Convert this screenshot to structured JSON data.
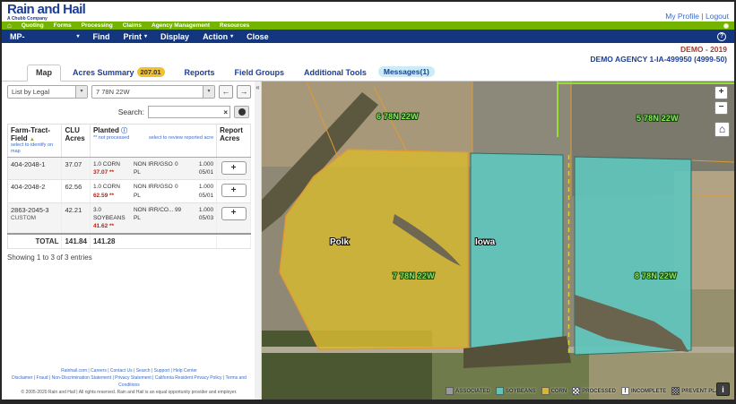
{
  "header": {
    "logo_title": "Rain and Hail",
    "logo_subtitle": "A Chubb Company",
    "profile": "My Profile",
    "divider": "|",
    "logout": "Logout"
  },
  "nav": {
    "items": [
      "Quoting",
      "Forms",
      "Processing",
      "Claims",
      "Agency Management",
      "Resources"
    ]
  },
  "toolbar": {
    "policy": "MP-",
    "caret": "▾",
    "find": "Find",
    "print": "Print",
    "display": "Display",
    "action": "Action",
    "close": "Close",
    "help": "?"
  },
  "agency": {
    "demo": "DEMO - 2019",
    "name": "DEMO AGENCY 1-IA-499950 (4999-50)"
  },
  "tabs": {
    "map": "Map",
    "acres_summary": "Acres Summary",
    "acres_badge": "207.01",
    "reports": "Reports",
    "field_groups": "Field Groups",
    "additional_tools": "Additional Tools",
    "messages": "Messages(1)"
  },
  "filters": {
    "list_by": "List by Legal",
    "legal": "7 78N 22W",
    "caret": "▾",
    "prev": "←",
    "next": "→",
    "collapse": "«"
  },
  "search": {
    "label": "Search:",
    "value": "",
    "clear": "×"
  },
  "table": {
    "headers": {
      "farm": "Farm-Tract-Field",
      "sort_icon": "▲",
      "farm_sub": "select to identify on map",
      "clu": "CLU Acres",
      "planted": "Planted",
      "info_icon": "ⓘ",
      "planted_sub_left": "** not processed",
      "planted_sub_right": "select to review reported acre",
      "report": "Report Acres"
    },
    "plus": "+",
    "rows": [
      {
        "field": "404-2048-1",
        "field_sub": "",
        "clu": "37.07",
        "crop": "1.0 CORN",
        "planted": "37.07 **",
        "practice": "NON IRR/GSO",
        "practice_type": "PL",
        "code": "0",
        "share": "1.000",
        "date": "05/01"
      },
      {
        "field": "404-2048-2",
        "field_sub": "",
        "clu": "62.56",
        "crop": "1.0 CORN",
        "planted": "62.59 **",
        "practice": "NON IRR/GSO",
        "practice_type": "PL",
        "code": "0",
        "share": "1.000",
        "date": "05/01"
      },
      {
        "field": "2863-2045-3",
        "field_sub": "CUSTOM",
        "clu": "42.21",
        "crop": "3.0 SOYBEANS",
        "planted": "41.62 **",
        "practice": "NON IRR/CO...",
        "practice_type": "PL",
        "code": "99",
        "share": "1.000",
        "date": "05/03"
      }
    ],
    "total": {
      "label": "TOTAL",
      "clu": "141.84",
      "planted": "141.28"
    },
    "showing": "Showing 1 to 3 of 3 entries"
  },
  "footer": {
    "line1": "Rainhail.com | Careers | Contact Us | Search | Support | Help Center",
    "line2": "Disclaimer | Fraud | Non-Discrimination Statement | Privacy Statement | California Resident Privacy Policy | Terms and Conditions",
    "line3": "© 2005-2020 Rain and Hail | All rights reserved. Rain and Hail is an equal opportunity provider and employer."
  },
  "map": {
    "sections": {
      "s6": "6 78N 22W",
      "s5": "5 78N 22W",
      "s7": "7 78N 22W",
      "s8": "8 78N 22W"
    },
    "counties": {
      "left": "Polk",
      "right": "Iowa"
    },
    "controls": {
      "zoom_in": "+",
      "zoom_out": "−",
      "home": "⌂",
      "info": "i"
    },
    "legend": {
      "associated": "ASSOCIATED",
      "soybeans": "SOYBEANS",
      "corn": "CORN",
      "processed": "PROCESSED",
      "incomplete": "INCOMPLETE",
      "incomplete_symbol": "!",
      "prevent_plant": "PREVENT PLANT"
    },
    "colors": {
      "corn": "#d5b832",
      "soybeans": "#5fc6bd",
      "associated": "#9a9a9a",
      "boundary_orange": "#e19a35",
      "section_label_green": "#86e84f"
    }
  }
}
